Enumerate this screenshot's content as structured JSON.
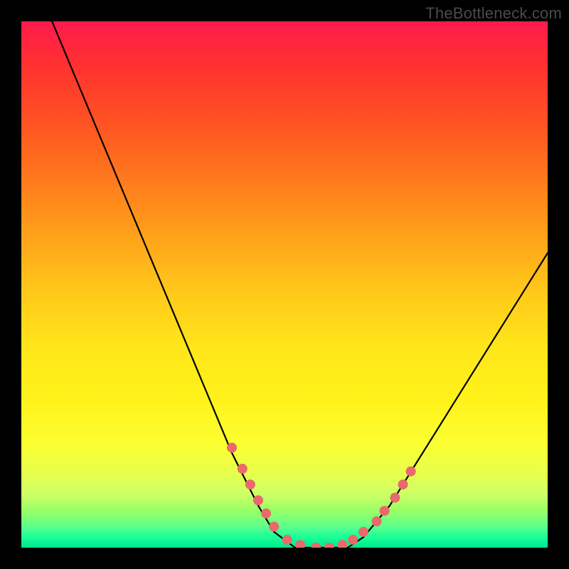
{
  "watermark": "TheBottleneck.com",
  "colors": {
    "frame": "#000000",
    "curve": "#000000",
    "marker_fill": "#e86a6a",
    "marker_stroke": "#d44a4a",
    "gradient_top": "#ff1a4d",
    "gradient_bottom": "#00e68c"
  },
  "chart_data": {
    "type": "line",
    "title": "",
    "xlabel": "",
    "ylabel": "",
    "xlim": [
      0,
      100
    ],
    "ylim": [
      0,
      100
    ],
    "grid": false,
    "legend": false,
    "series": [
      {
        "name": "bottleneck-curve",
        "x": [
          0,
          5,
          10,
          15,
          20,
          25,
          30,
          35,
          40,
          45,
          48,
          52,
          55,
          58,
          62,
          65,
          70,
          75,
          80,
          85,
          90,
          95,
          100
        ],
        "y": [
          115,
          102,
          90,
          78,
          66,
          54,
          42,
          30,
          18,
          8,
          3,
          0,
          0,
          0,
          0,
          2,
          8,
          16,
          24,
          32,
          40,
          48,
          56
        ]
      }
    ],
    "markers": [
      {
        "x": 40,
        "y": 19
      },
      {
        "x": 42,
        "y": 15
      },
      {
        "x": 43.5,
        "y": 12
      },
      {
        "x": 45,
        "y": 9
      },
      {
        "x": 46.5,
        "y": 6.5
      },
      {
        "x": 48,
        "y": 4
      },
      {
        "x": 50.5,
        "y": 1.5
      },
      {
        "x": 53,
        "y": 0.5
      },
      {
        "x": 56,
        "y": 0
      },
      {
        "x": 58.5,
        "y": 0
      },
      {
        "x": 61,
        "y": 0.5
      },
      {
        "x": 63,
        "y": 1.5
      },
      {
        "x": 65,
        "y": 3
      },
      {
        "x": 67.5,
        "y": 5
      },
      {
        "x": 69,
        "y": 7
      },
      {
        "x": 71,
        "y": 9.5
      },
      {
        "x": 72.5,
        "y": 12
      },
      {
        "x": 74,
        "y": 14.5
      }
    ]
  }
}
